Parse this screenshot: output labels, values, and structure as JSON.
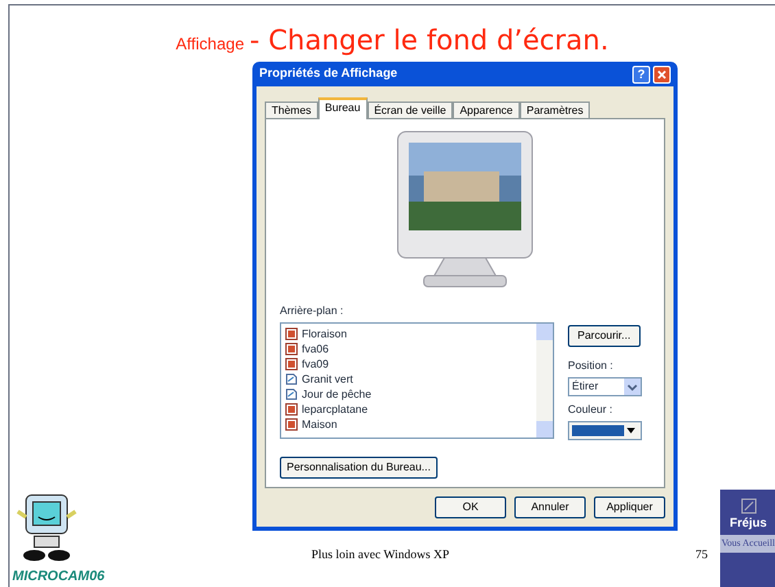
{
  "slide": {
    "title_small": "Affichage",
    "title_main": "- Changer le fond d’écran.",
    "footer": "Plus loin avec Windows XP",
    "page_number": "75",
    "logo_text": "MICROCAM06",
    "badge_title": "Fréjus",
    "badge_text": "Vous Accueill"
  },
  "window": {
    "title": "Propriétés de Affichage",
    "help_button": "?"
  },
  "tabs": [
    {
      "label": "Thèmes",
      "selected": false
    },
    {
      "label": "Bureau",
      "selected": true
    },
    {
      "label": "Écran de veille",
      "selected": false
    },
    {
      "label": "Apparence",
      "selected": false
    },
    {
      "label": "Paramètres",
      "selected": false
    }
  ],
  "background": {
    "label": "Arrière-plan :",
    "items": [
      {
        "name": "Floraison",
        "kind": "image"
      },
      {
        "name": "fva06",
        "kind": "image"
      },
      {
        "name": "fva09",
        "kind": "image"
      },
      {
        "name": "Granit vert",
        "kind": "page"
      },
      {
        "name": "Jour de pêche",
        "kind": "page"
      },
      {
        "name": "leparcplatane",
        "kind": "image"
      },
      {
        "name": "Maison",
        "kind": "image"
      }
    ]
  },
  "browse_button": "Parcourir...",
  "position": {
    "label": "Position :",
    "value": "Étirer"
  },
  "color": {
    "label": "Couleur :"
  },
  "customize_button": "Personnalisation du Bureau...",
  "buttons": [
    "OK",
    "Annuler",
    "Appliquer"
  ]
}
